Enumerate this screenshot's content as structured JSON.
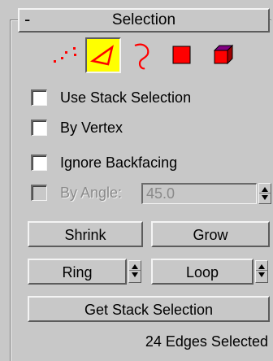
{
  "rollout": {
    "collapse_symbol": "-",
    "title": "Selection"
  },
  "subobject_levels": [
    {
      "name": "vertex",
      "active": false
    },
    {
      "name": "edge",
      "active": true
    },
    {
      "name": "border",
      "active": false
    },
    {
      "name": "polygon",
      "active": false
    },
    {
      "name": "element",
      "active": false
    }
  ],
  "options": {
    "use_stack_selection": {
      "label": "Use Stack Selection",
      "checked": false
    },
    "by_vertex": {
      "label": "By Vertex",
      "checked": false
    },
    "ignore_backfacing": {
      "label": "Ignore Backfacing",
      "checked": false
    },
    "by_angle": {
      "label": "By Angle:",
      "checked": false,
      "disabled": true,
      "value": "45.0"
    }
  },
  "buttons": {
    "shrink": "Shrink",
    "grow": "Grow",
    "ring": "Ring",
    "loop": "Loop",
    "get_stack_selection": "Get Stack Selection"
  },
  "status": "24 Edges Selected",
  "colors": {
    "panel": "#c8c8c8",
    "active_highlight": "#ffff00",
    "vertex_dots": "#ff0000",
    "edge_icon": "#ff0000",
    "polygon_fill": "#ff0000",
    "element_top": "#800080"
  }
}
